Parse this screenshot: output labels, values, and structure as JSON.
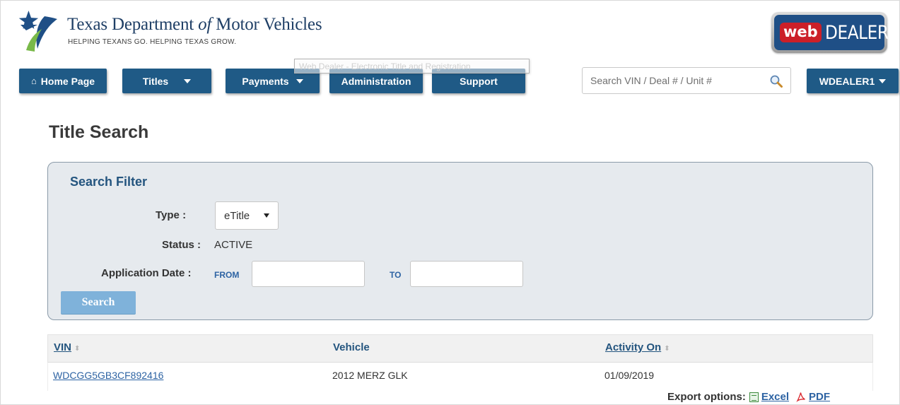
{
  "header": {
    "agency_name_pre": "Texas Department ",
    "agency_name_of": "of",
    "agency_name_post": " Motor Vehicles",
    "agency_tagline": "HELPING TEXANS GO. HELPING TEXAS GROW.",
    "brand_web": "web",
    "brand_dealer": "DEALER"
  },
  "tooltip": "Web Dealer - Electronic Title and Registration",
  "nav": {
    "home_icon": "⌂",
    "home": "Home Page",
    "titles": "Titles",
    "payments": "Payments",
    "administration": "Administration",
    "support": "Support",
    "search_placeholder": "Search VIN / Deal # / Unit #",
    "user": "WDEALER1"
  },
  "page": {
    "title": "Title Search"
  },
  "filter": {
    "heading": "Search Filter",
    "type_label": "Type :",
    "type_value": "eTitle",
    "status_label": "Status :",
    "status_value": "ACTIVE",
    "app_date_label": "Application Date :",
    "from_label": "FROM",
    "to_label": "TO",
    "from_value": "",
    "to_value": "",
    "search_button": "Search"
  },
  "table": {
    "columns": {
      "vin": "VIN",
      "vehicle": "Vehicle",
      "activity_on": "Activity On"
    },
    "sort_glyph": "⬍",
    "rows": [
      {
        "vin": "WDCGG5GB3CF892416",
        "vehicle": "2012 MERZ GLK",
        "activity_on": "01/09/2019"
      }
    ]
  },
  "export": {
    "label": "Export options:",
    "excel": "Excel",
    "pdf": "PDF"
  },
  "colors": {
    "nav_blue": "#1f5a86",
    "link_blue": "#2d63a3",
    "panel_bg": "#e6eaee",
    "brand_red": "#cc1f28"
  }
}
